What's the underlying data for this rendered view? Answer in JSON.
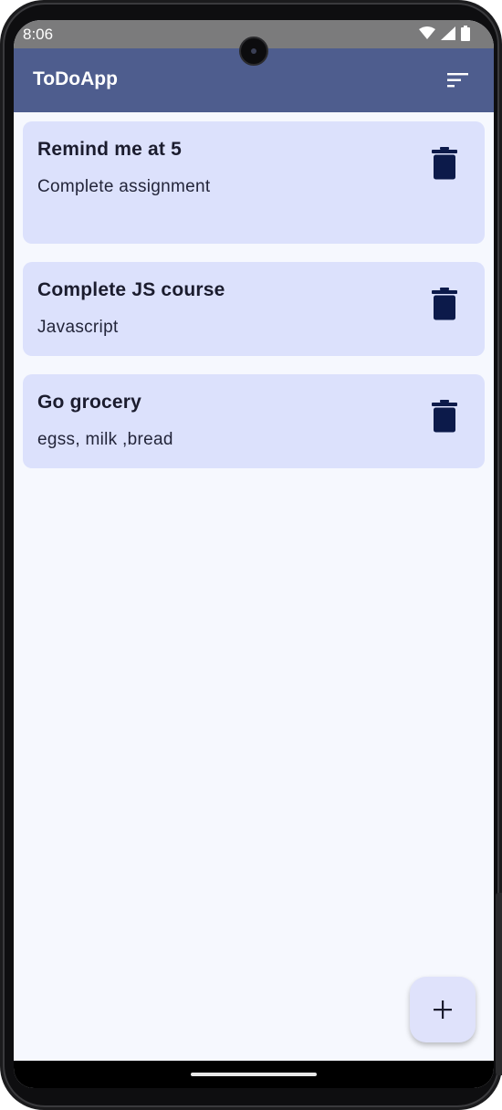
{
  "status_bar": {
    "time": "8:06",
    "icons": [
      "wifi-icon",
      "cellular-signal-icon",
      "battery-icon"
    ]
  },
  "app_bar": {
    "title": "ToDoApp",
    "sort_icon": "sort-icon",
    "background": "#4e5d8e"
  },
  "todos": [
    {
      "title": "Remind me at 5",
      "description": "Complete assignment",
      "delete_icon": "trash-icon"
    },
    {
      "title": "Complete JS course",
      "description": "Javascript",
      "delete_icon": "trash-icon"
    },
    {
      "title": "Go grocery",
      "description": "egss, milk ,bread",
      "delete_icon": "trash-icon"
    }
  ],
  "fab": {
    "icon": "plus-icon"
  },
  "colors": {
    "card_background": "#dce1fc",
    "screen_background": "#f6f8fe",
    "icon_dark": "#0c1a4a"
  }
}
